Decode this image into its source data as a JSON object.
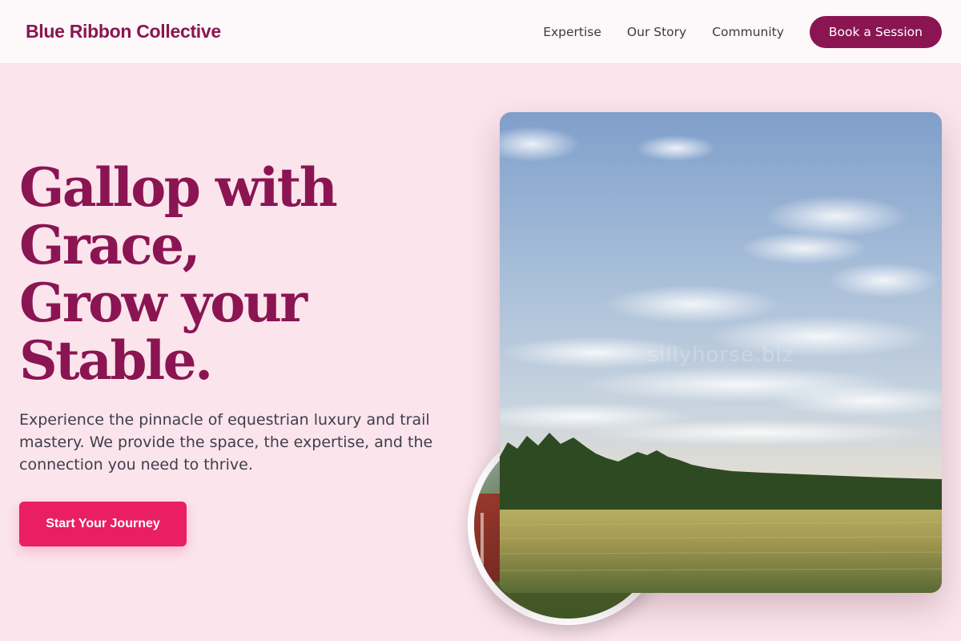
{
  "header": {
    "logo": "Blue Ribbon Collective",
    "nav": [
      "Expertise",
      "Our Story",
      "Community"
    ],
    "cta": "Book a Session"
  },
  "hero": {
    "title_lines": [
      "Gallop with",
      "Grace,",
      "Grow your",
      "Stable."
    ],
    "subtitle": "Experience the pinnacle of equestrian luxury and trail mastery. We provide the space, the expertise, and the connection you need to thrive.",
    "cta": "Start Your Journey",
    "watermark": "sillyhorse.biz"
  },
  "colors": {
    "brand": "#8a1552",
    "accent": "#e91e63",
    "background": "#fbe4ec"
  }
}
